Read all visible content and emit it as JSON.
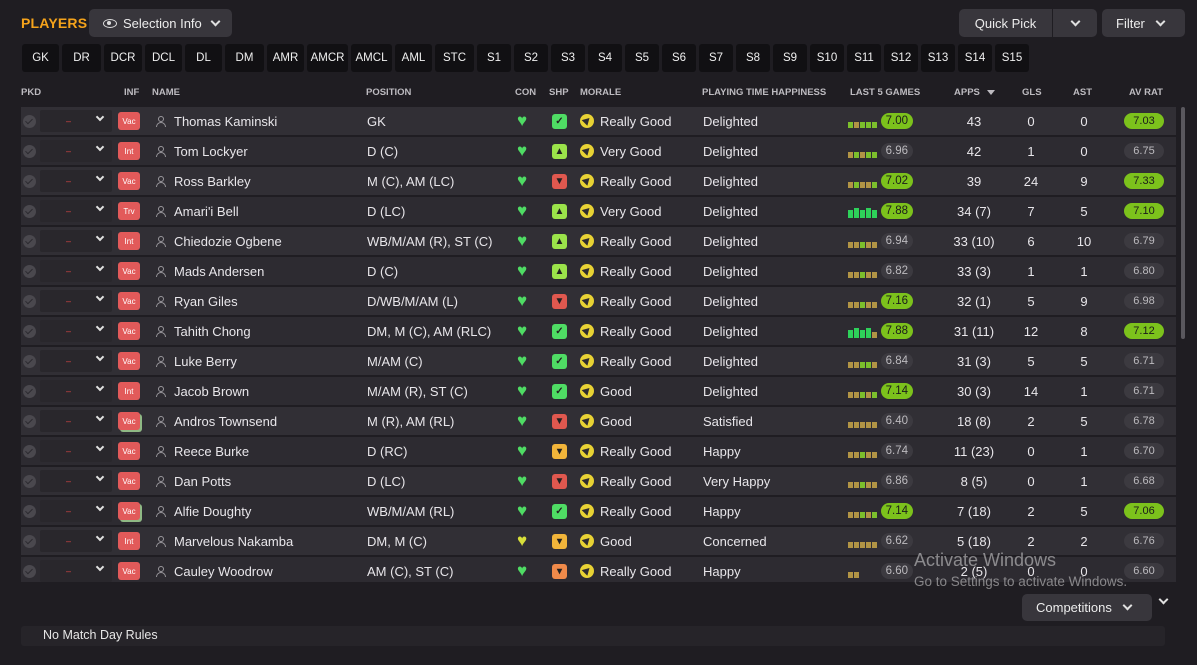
{
  "header": {
    "title": "PLAYERS",
    "selection_info": "Selection Info",
    "quick_pick": "Quick Pick",
    "filter": "Filter"
  },
  "position_tabs": [
    "GK",
    "DR",
    "DCR",
    "DCL",
    "DL",
    "DM",
    "AMR",
    "AMCR",
    "AMCL",
    "AML",
    "STC",
    "S1",
    "S2",
    "S3",
    "S4",
    "S5",
    "S6",
    "S7",
    "S8",
    "S9",
    "S10",
    "S11",
    "S12",
    "S13",
    "S14",
    "S15"
  ],
  "columns": {
    "pkd": "PKD",
    "inf": "INF",
    "name": "NAME",
    "position": "POSITION",
    "con": "CON",
    "shp": "SHP",
    "morale": "MORALE",
    "playing_time": "PLAYING TIME HAPPINESS",
    "last5": "LAST 5 GAMES",
    "apps": "APPS",
    "gls": "GLS",
    "ast": "AST",
    "avrat": "AV RAT"
  },
  "colors": {
    "accent": "#f5a31b",
    "badge": "#e25a5a",
    "good_green": "#7cc21c"
  },
  "players": [
    {
      "inf": "Vac",
      "name": "Thomas Kaminski",
      "position": "GK",
      "con": "green",
      "shp": "green",
      "morale": "Really Good",
      "happiness": "Delighted",
      "last5": "7.00",
      "last5_hi": true,
      "bars": [
        "g",
        "o",
        "g",
        "g",
        "g"
      ],
      "apps": "43",
      "gls": "0",
      "ast": "0",
      "avrat": "7.03",
      "avrat_hi": true
    },
    {
      "inf": "Int",
      "name": "Tom Lockyer",
      "position": "D (C)",
      "con": "green",
      "shp": "lime",
      "morale": "Very Good",
      "happiness": "Delighted",
      "last5": "6.96",
      "last5_hi": false,
      "bars": [
        "o",
        "g",
        "o",
        "g",
        "g"
      ],
      "apps": "42",
      "gls": "1",
      "ast": "0",
      "avrat": "6.75",
      "avrat_hi": false
    },
    {
      "inf": "Vac",
      "name": "Ross Barkley",
      "position": "M (C), AM (LC)",
      "con": "green",
      "shp": "red",
      "morale": "Really Good",
      "happiness": "Delighted",
      "last5": "7.02",
      "last5_hi": true,
      "bars": [
        "o",
        "g",
        "o",
        "o",
        "g"
      ],
      "apps": "39",
      "gls": "24",
      "ast": "9",
      "avrat": "7.33",
      "avrat_hi": true
    },
    {
      "inf": "Trv",
      "name": "Amari'i Bell",
      "position": "D (LC)",
      "con": "green",
      "shp": "lime",
      "morale": "Very Good",
      "happiness": "Delighted",
      "last5": "7.88",
      "last5_hi": true,
      "bars": [
        "G",
        "G",
        "G",
        "G",
        "G"
      ],
      "apps": "34 (7)",
      "gls": "7",
      "ast": "5",
      "avrat": "7.10",
      "avrat_hi": true
    },
    {
      "inf": "Int",
      "name": "Chiedozie Ogbene",
      "position": "WB/M/AM (R), ST (C)",
      "con": "green",
      "shp": "lime",
      "morale": "Really Good",
      "happiness": "Delighted",
      "last5": "6.94",
      "last5_hi": false,
      "bars": [
        "o",
        "o",
        "g",
        "o",
        "o"
      ],
      "apps": "33 (10)",
      "gls": "6",
      "ast": "10",
      "avrat": "6.79",
      "avrat_hi": false
    },
    {
      "inf": "Vac",
      "name": "Mads Andersen",
      "position": "D (C)",
      "con": "green",
      "shp": "lime",
      "morale": "Really Good",
      "happiness": "Delighted",
      "last5": "6.82",
      "last5_hi": false,
      "bars": [
        "o",
        "o",
        "g",
        "o",
        "o"
      ],
      "apps": "33 (3)",
      "gls": "1",
      "ast": "1",
      "avrat": "6.80",
      "avrat_hi": false
    },
    {
      "inf": "Vac",
      "name": "Ryan Giles",
      "position": "D/WB/M/AM (L)",
      "con": "green",
      "shp": "red",
      "morale": "Really Good",
      "happiness": "Delighted",
      "last5": "7.16",
      "last5_hi": true,
      "bars": [
        "o",
        "o",
        "g",
        "o",
        "o"
      ],
      "apps": "32 (1)",
      "gls": "5",
      "ast": "9",
      "avrat": "6.98",
      "avrat_hi": false
    },
    {
      "inf": "Vac",
      "name": "Tahith Chong",
      "position": "DM, M (C), AM (RLC)",
      "con": "green",
      "shp": "green",
      "morale": "Really Good",
      "happiness": "Delighted",
      "last5": "7.88",
      "last5_hi": true,
      "bars": [
        "G",
        "G",
        "G",
        "G",
        "o"
      ],
      "apps": "31 (11)",
      "gls": "12",
      "ast": "8",
      "avrat": "7.12",
      "avrat_hi": true
    },
    {
      "inf": "Vac",
      "name": "Luke Berry",
      "position": "M/AM (C)",
      "con": "green",
      "shp": "green",
      "morale": "Really Good",
      "happiness": "Delighted",
      "last5": "6.84",
      "last5_hi": false,
      "bars": [
        "o",
        "o",
        "g",
        "g",
        "o"
      ],
      "apps": "31 (3)",
      "gls": "5",
      "ast": "5",
      "avrat": "6.71",
      "avrat_hi": false
    },
    {
      "inf": "Int",
      "name": "Jacob Brown",
      "position": "M/AM (R), ST (C)",
      "con": "green",
      "shp": "green",
      "morale": "Good",
      "happiness": "Delighted",
      "last5": "7.14",
      "last5_hi": true,
      "bars": [
        "o",
        "o",
        "g",
        "o",
        "g"
      ],
      "apps": "30 (3)",
      "gls": "14",
      "ast": "1",
      "avrat": "6.71",
      "avrat_hi": false
    },
    {
      "inf": "Vac",
      "name": "Andros Townsend",
      "position": "M (R), AM (RL)",
      "con": "green",
      "shp": "red",
      "morale": "Good",
      "happiness": "Satisfied",
      "last5": "6.40",
      "last5_hi": false,
      "bars": [
        "o",
        "o",
        "o",
        "o",
        "o"
      ],
      "apps": "18 (8)",
      "gls": "2",
      "ast": "5",
      "avrat": "6.78",
      "avrat_hi": false
    },
    {
      "inf": "Vac",
      "name": "Reece Burke",
      "position": "D (RC)",
      "con": "green",
      "shp": "amber",
      "morale": "Really Good",
      "happiness": "Happy",
      "last5": "6.74",
      "last5_hi": false,
      "bars": [
        "o",
        "o",
        "g",
        "o",
        "o"
      ],
      "apps": "11 (23)",
      "gls": "0",
      "ast": "1",
      "avrat": "6.70",
      "avrat_hi": false
    },
    {
      "inf": "Vac",
      "name": "Dan Potts",
      "position": "D (LC)",
      "con": "green",
      "shp": "red",
      "morale": "Really Good",
      "happiness": "Very Happy",
      "last5": "6.86",
      "last5_hi": false,
      "bars": [
        "o",
        "o",
        "g",
        "o",
        "o"
      ],
      "apps": "8 (5)",
      "gls": "0",
      "ast": "1",
      "avrat": "6.68",
      "avrat_hi": false
    },
    {
      "inf": "Vac",
      "name": "Alfie Doughty",
      "position": "WB/M/AM (RL)",
      "con": "green",
      "shp": "green",
      "morale": "Really Good",
      "happiness": "Happy",
      "last5": "7.14",
      "last5_hi": true,
      "bars": [
        "o",
        "o",
        "g",
        "o",
        "g"
      ],
      "apps": "7 (18)",
      "gls": "2",
      "ast": "5",
      "avrat": "7.06",
      "avrat_hi": true
    },
    {
      "inf": "Int",
      "name": "Marvelous Nakamba",
      "position": "DM, M (C)",
      "con": "yellow",
      "shp": "amber",
      "morale": "Good",
      "happiness": "Concerned",
      "last5": "6.62",
      "last5_hi": false,
      "bars": [
        "o",
        "o",
        "o",
        "o",
        "o"
      ],
      "apps": "5 (18)",
      "gls": "2",
      "ast": "2",
      "avrat": "6.76",
      "avrat_hi": false
    },
    {
      "inf": "Vac",
      "name": "Cauley Woodrow",
      "position": "AM (C), ST (C)",
      "con": "green",
      "shp": "orange",
      "morale": "Really Good",
      "happiness": "Happy",
      "last5": "6.60",
      "last5_hi": false,
      "bars": [
        "o",
        "o",
        "",
        "",
        ""
      ],
      "apps": "2 (5)",
      "gls": "0",
      "ast": "0",
      "avrat": "6.60",
      "avrat_hi": false
    }
  ],
  "footer": {
    "competitions": "Competitions",
    "match_day_rules": "No Match Day Rules"
  },
  "watermark": {
    "line1": "Activate Windows",
    "line2": "Go to Settings to activate Windows."
  }
}
